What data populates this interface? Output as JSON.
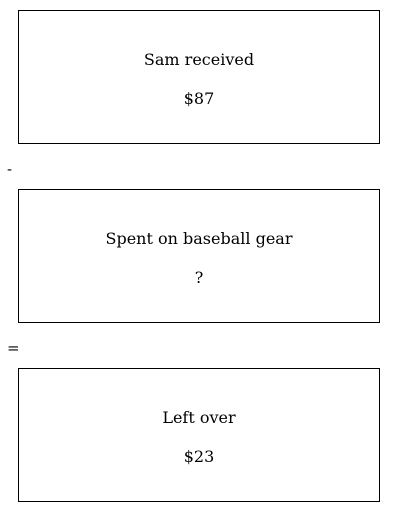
{
  "boxes": [
    {
      "label": "Sam received",
      "value": "$87"
    },
    {
      "label": "Spent on baseball gear",
      "value": "?"
    },
    {
      "label": "Left over",
      "value": "$23"
    }
  ],
  "operators": {
    "minus": "-",
    "equals": "="
  }
}
